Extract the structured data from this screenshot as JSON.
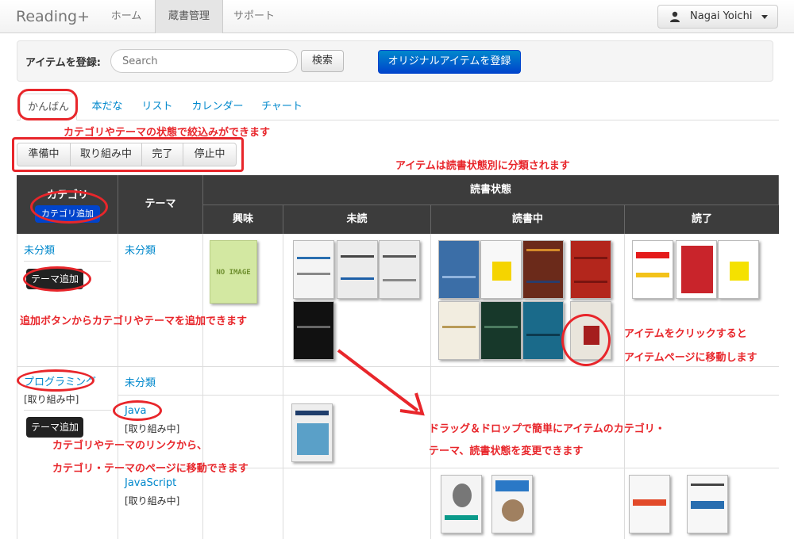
{
  "navbar": {
    "brand": "Reading+",
    "items": [
      "ホーム",
      "蔵書管理",
      "サポート"
    ],
    "user": "Nagai Yoichi"
  },
  "register": {
    "label": "アイテムを登録:",
    "placeholder": "Search",
    "search_button": "検索",
    "original_button": "オリジナルアイテムを登録"
  },
  "tabs": [
    "かんばん",
    "本だな",
    "リスト",
    "カレンダー",
    "チャート"
  ],
  "filters": [
    "準備中",
    "取り組み中",
    "完了",
    "停止中"
  ],
  "table": {
    "col_category": "カテゴリ",
    "add_category": "カテゴリ追加",
    "col_theme": "テーマ",
    "col_reading_state": "読書状態",
    "states": [
      "興味",
      "未読",
      "読書中",
      "読了"
    ],
    "rows": {
      "uncat_category": "未分類",
      "uncat_theme": "未分類",
      "add_theme": "テーマ追加",
      "prog_category": "プログラミング",
      "prog_status": "[取り組み中]",
      "prog_theme_uncat": "未分類",
      "java_theme": "Java",
      "java_status": "[取り組み中]",
      "js_theme": "JavaScript",
      "js_status": "[取り組み中]",
      "no_image": "NO IMAGE"
    }
  },
  "annotations": {
    "filter": "カテゴリやテーマの状態で絞込みができます",
    "classify": "アイテムは読書状態別に分類されます",
    "add": "追加ボタンからカテゴリやテーマを追加できます",
    "click1": "アイテムをクリックすると",
    "click2": "アイテムページに移動します",
    "drag1": "ドラッグ＆ドロップで簡単にアイテムのカテゴリ・",
    "drag2": "テーマ、読書状態を変更できます",
    "link1": "カテゴリやテーマのリンクから、",
    "link2": "カテゴリ・テーマのページに移動できます"
  },
  "colors": {
    "accent": "#0044cc",
    "annotation": "#e8262b",
    "header": "#3c3c3c"
  }
}
